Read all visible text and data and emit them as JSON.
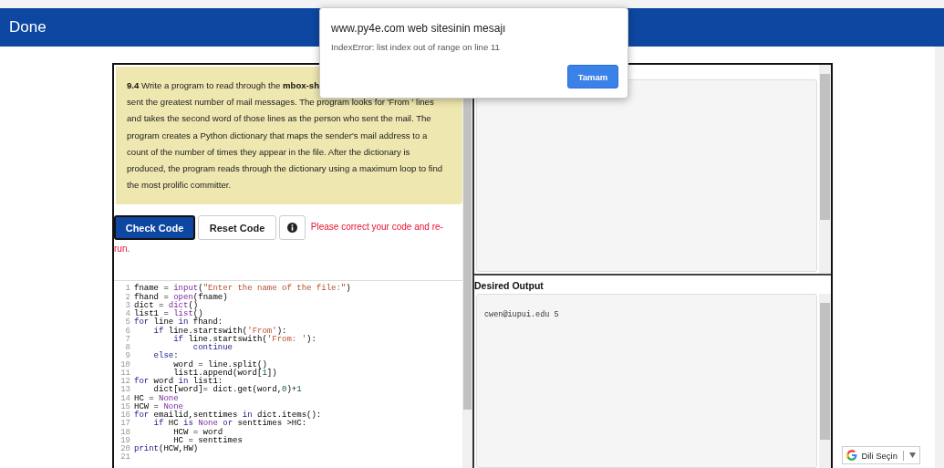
{
  "header": {
    "title": "Done"
  },
  "instructions": {
    "lines": [
      "**9.4** Write a program to read through the **mbox-sh**",
      "sent the greatest number of mail messages. The program looks for 'From ' lines",
      "and takes the second word of those lines as the person who sent the mail. The",
      "program creates a Python dictionary that maps the sender's mail address to a",
      "count of the number of times they appear in the file. After the dictionary is",
      "produced, the program reads through the dictionary using a maximum loop to find",
      "the most prolific committer."
    ]
  },
  "buttons": [
    {
      "label": "Check Code",
      "kind": "primary"
    },
    {
      "label": "Reset Code",
      "kind": "secondary"
    },
    {
      "kind": "info"
    }
  ],
  "error_message_lines": [
    "Please correct your code and re-",
    "run."
  ],
  "code": [
    {
      "number": "1",
      "tokens": [
        {
          "text": "fname = ",
          "kind": "plain"
        },
        {
          "text": "input",
          "kind": "builtin"
        },
        {
          "text": "(",
          "kind": "plain"
        },
        {
          "text": "\"Enter the name of the file:\"",
          "kind": "string"
        },
        {
          "text": ")",
          "kind": "plain"
        }
      ]
    },
    {
      "number": "2",
      "tokens": [
        {
          "text": "fhand = ",
          "kind": "plain"
        },
        {
          "text": "open",
          "kind": "builtin"
        },
        {
          "text": "(fname)",
          "kind": "plain"
        }
      ]
    },
    {
      "number": "3",
      "tokens": [
        {
          "text": "dict = ",
          "kind": "plain"
        },
        {
          "text": "dict",
          "kind": "builtin"
        },
        {
          "text": "()",
          "kind": "plain"
        }
      ]
    },
    {
      "number": "4",
      "tokens": [
        {
          "text": "list1 = ",
          "kind": "plain"
        },
        {
          "text": "list",
          "kind": "builtin"
        },
        {
          "text": "()",
          "kind": "plain"
        }
      ]
    },
    {
      "number": "5",
      "tokens": [
        {
          "text": "for",
          "kind": "keyword"
        },
        {
          "text": " line ",
          "kind": "plain"
        },
        {
          "text": "in",
          "kind": "keyword"
        },
        {
          "text": " fhand:",
          "kind": "plain"
        }
      ]
    },
    {
      "number": "6",
      "tokens": [
        {
          "text": "    if",
          "kind": "keyword"
        },
        {
          "text": " line.startswith(",
          "kind": "plain"
        },
        {
          "text": "'From'",
          "kind": "string"
        },
        {
          "text": "):",
          "kind": "plain"
        }
      ]
    },
    {
      "number": "7",
      "tokens": [
        {
          "text": "        if",
          "kind": "keyword"
        },
        {
          "text": " line.startswith(",
          "kind": "plain"
        },
        {
          "text": "'From: '",
          "kind": "string"
        },
        {
          "text": "):",
          "kind": "plain"
        }
      ]
    },
    {
      "number": "8",
      "tokens": [
        {
          "text": "            continue",
          "kind": "keyword"
        }
      ]
    },
    {
      "number": "9",
      "tokens": [
        {
          "text": "    else",
          "kind": "keyword"
        },
        {
          "text": ":",
          "kind": "plain"
        }
      ]
    },
    {
      "number": "10",
      "tokens": [
        {
          "text": "        word = line.split()",
          "kind": "plain"
        }
      ]
    },
    {
      "number": "11",
      "tokens": [
        {
          "text": "        list1.append(word[",
          "kind": "plain"
        },
        {
          "text": "1",
          "kind": "number"
        },
        {
          "text": "])",
          "kind": "plain"
        }
      ]
    },
    {
      "number": "12",
      "tokens": [
        {
          "text": "for",
          "kind": "keyword"
        },
        {
          "text": " word ",
          "kind": "plain"
        },
        {
          "text": "in",
          "kind": "keyword"
        },
        {
          "text": " list1:",
          "kind": "plain"
        }
      ]
    },
    {
      "number": "13",
      "tokens": [
        {
          "text": "    dict[word]= dict.get(word,",
          "kind": "plain"
        },
        {
          "text": "0",
          "kind": "number"
        },
        {
          "text": ")+",
          "kind": "plain"
        },
        {
          "text": "1",
          "kind": "number"
        }
      ]
    },
    {
      "number": "14",
      "tokens": [
        {
          "text": "HC = ",
          "kind": "plain"
        },
        {
          "text": "None",
          "kind": "builtin"
        }
      ]
    },
    {
      "number": "15",
      "tokens": [
        {
          "text": "HCW = ",
          "kind": "plain"
        },
        {
          "text": "None",
          "kind": "builtin"
        }
      ]
    },
    {
      "number": "16",
      "tokens": [
        {
          "text": "for",
          "kind": "keyword"
        },
        {
          "text": " emailid,senttimes ",
          "kind": "plain"
        },
        {
          "text": "in",
          "kind": "keyword"
        },
        {
          "text": " dict.items():",
          "kind": "plain"
        }
      ]
    },
    {
      "number": "17",
      "tokens": [
        {
          "text": "    if",
          "kind": "keyword"
        },
        {
          "text": " HC ",
          "kind": "plain"
        },
        {
          "text": "is",
          "kind": "keyword"
        },
        {
          "text": " None",
          "kind": "builtin"
        },
        {
          "text": " or",
          "kind": "keyword"
        },
        {
          "text": " senttimes >HC:",
          "kind": "plain"
        }
      ]
    },
    {
      "number": "18",
      "tokens": [
        {
          "text": "        HCW = word",
          "kind": "plain"
        }
      ]
    },
    {
      "number": "19",
      "tokens": [
        {
          "text": "        HC = senttimes",
          "kind": "plain"
        }
      ]
    },
    {
      "number": "20",
      "tokens": [
        {
          "text": "print",
          "kind": "keyword"
        },
        {
          "text": "(HCW,HW)",
          "kind": "plain"
        }
      ]
    },
    {
      "number": "21"
    }
  ],
  "desired_output": {
    "title": "Desired Output",
    "text": "cwen@iupui.edu 5"
  },
  "language_widget": {
    "label": "Dili Seçin"
  },
  "dialog": {
    "title": "www.py4e.com web sitesinin mesajı",
    "message": "IndexError: list index out of range on line 11",
    "button": "Tamam"
  }
}
